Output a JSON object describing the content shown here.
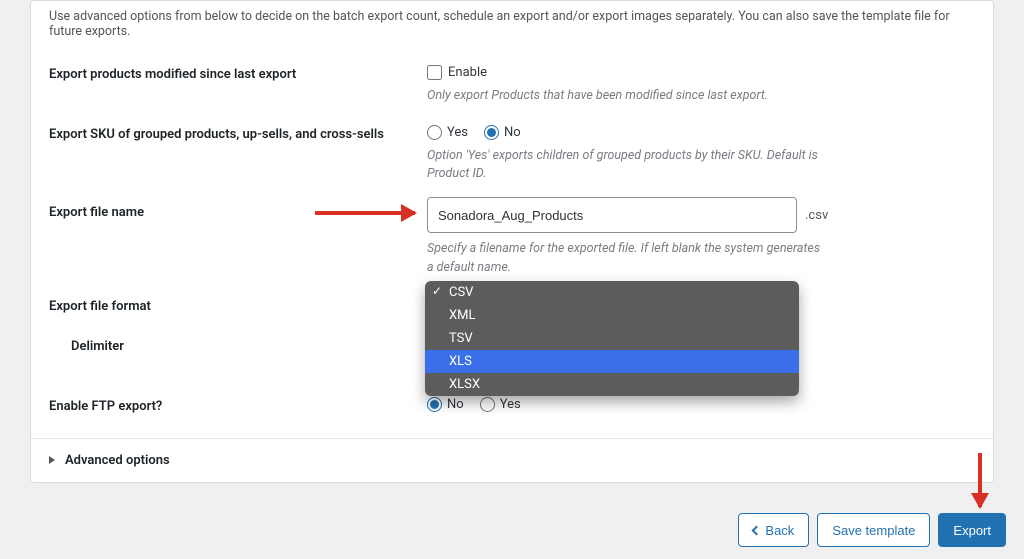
{
  "intro": "Use advanced options from below to decide on the batch export count, schedule an export and/or export images separately. You can also save the template file for future exports.",
  "fields": {
    "modified": {
      "label": "Export products modified since last export",
      "enable_label": "Enable",
      "help": "Only export Products that have been modified since last export."
    },
    "sku": {
      "label": "Export SKU of grouped products, up-sells, and cross-sells",
      "yes": "Yes",
      "no": "No",
      "selected": "no",
      "help": "Option 'Yes' exports children of grouped products by their SKU. Default is Product ID."
    },
    "filename": {
      "label": "Export file name",
      "value": "Sonadora_Aug_Products",
      "suffix": ".csv",
      "help": "Specify a filename for the exported file. If left blank the system generates a default name."
    },
    "format": {
      "label": "Export file format",
      "options": [
        "CSV",
        "XML",
        "TSV",
        "XLS",
        "XLSX"
      ],
      "selected": "CSV",
      "highlighted": "XLS"
    },
    "delimiter": {
      "label": "Delimiter"
    },
    "ftp": {
      "label": "Enable FTP export?",
      "yes": "Yes",
      "no": "No",
      "selected": "no"
    },
    "advanced": {
      "label": "Advanced options"
    }
  },
  "buttons": {
    "back": "Back",
    "save_template": "Save template",
    "export": "Export"
  }
}
